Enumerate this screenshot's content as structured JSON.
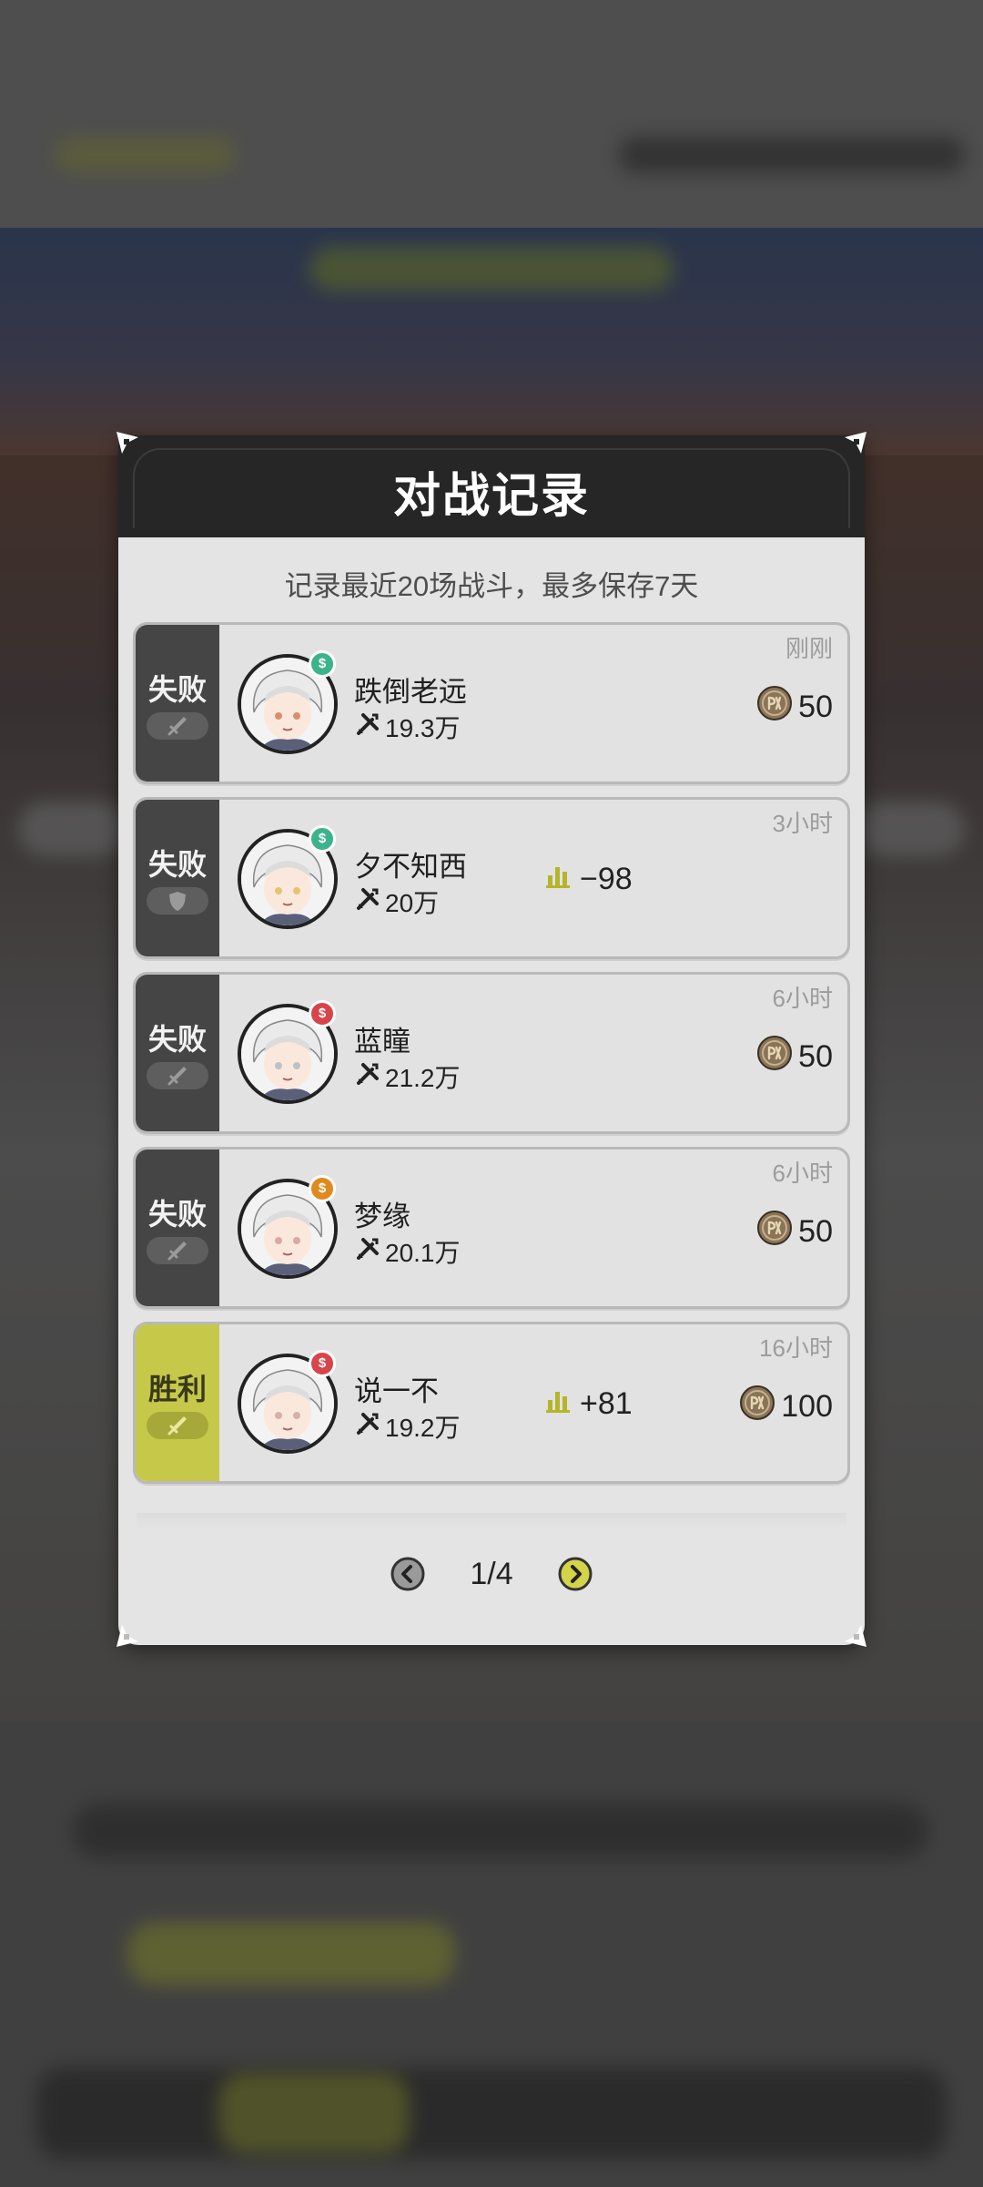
{
  "dialog": {
    "title": "对战记录",
    "subtitle": "记录最近20场战斗，最多保存7天"
  },
  "records": [
    {
      "result": "失败",
      "win": false,
      "name": "跌倒老远",
      "power": "19.3万",
      "time": "刚刚",
      "coin": "50",
      "score": null,
      "avatar_color": "#d98f6a",
      "rank_color": "#3bb38b",
      "badge_icon": "sword-icon"
    },
    {
      "result": "失败",
      "win": false,
      "name": "夕不知西",
      "power": "20万",
      "time": "3小时",
      "coin": null,
      "score": "−98",
      "avatar_color": "#e8c36b",
      "rank_color": "#3bb38b",
      "badge_icon": "shield-icon"
    },
    {
      "result": "失败",
      "win": false,
      "name": "蓝瞳",
      "power": "21.2万",
      "time": "6小时",
      "coin": "50",
      "score": null,
      "avatar_color": "#bfbfc8",
      "rank_color": "#d9434a",
      "badge_icon": "sword-icon"
    },
    {
      "result": "失败",
      "win": false,
      "name": "梦缘",
      "power": "20.1万",
      "time": "6小时",
      "coin": "50",
      "score": null,
      "avatar_color": "#d9a8a8",
      "rank_color": "#e08a1e",
      "badge_icon": "sword-icon"
    },
    {
      "result": "胜利",
      "win": true,
      "name": "说一不",
      "power": "19.2万",
      "time": "16小时",
      "coin": "100",
      "score": "+81",
      "avatar_color": "#d6b0b0",
      "rank_color": "#d9434a",
      "badge_icon": "sword-icon"
    }
  ],
  "pager": {
    "text": "1/4"
  },
  "colors": {
    "header": "#262626",
    "win": "#c6c84a",
    "lose": "#454545",
    "score_icon": "#b5b52a",
    "coin": "#8a7458"
  }
}
